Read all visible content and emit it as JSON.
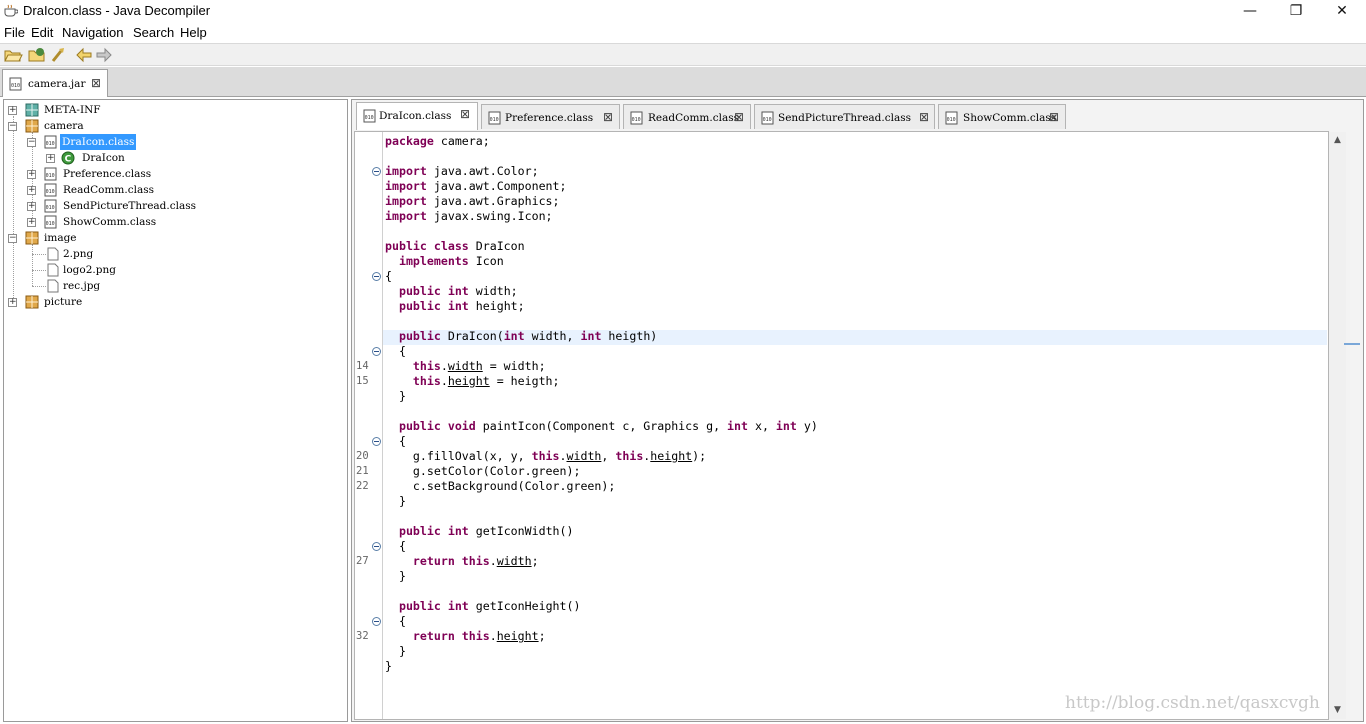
{
  "window": {
    "title": "DraIcon.class - Java Decompiler",
    "controls": {
      "minimize": "—",
      "maximize": "❐",
      "close": "✕"
    }
  },
  "menu": [
    "File",
    "Edit",
    "Navigation",
    "Search",
    "Help"
  ],
  "toolbar": {
    "buttons": [
      "open-file-icon",
      "open-type-icon",
      "open-type-hierarchy-icon",
      "back-icon",
      "forward-icon"
    ]
  },
  "outer_tabs": [
    {
      "label": "camera.jar",
      "icon": "jar-file-icon"
    }
  ],
  "tree": {
    "items": [
      {
        "label": "META-INF",
        "icon": "folder-package-icon",
        "expander": "+"
      },
      {
        "label": "camera",
        "icon": "package-icon",
        "expander": "−"
      },
      {
        "label": "DraIcon.class",
        "icon": "class-file-icon",
        "expander": "−",
        "selected": true
      },
      {
        "label": "DraIcon",
        "icon": "class-icon",
        "expander": "+"
      },
      {
        "label": "Preference.class",
        "icon": "class-file-icon",
        "expander": "+"
      },
      {
        "label": "ReadComm.class",
        "icon": "class-file-icon",
        "expander": "+"
      },
      {
        "label": "SendPictureThread.class",
        "icon": "class-file-icon",
        "expander": "+"
      },
      {
        "label": "ShowComm.class",
        "icon": "class-file-icon",
        "expander": "+"
      },
      {
        "label": "image",
        "icon": "package-icon",
        "expander": "−"
      },
      {
        "label": "2.png",
        "icon": "file-icon",
        "expander": ""
      },
      {
        "label": "logo2.png",
        "icon": "file-icon",
        "expander": ""
      },
      {
        "label": "rec.jpg",
        "icon": "file-icon",
        "expander": ""
      },
      {
        "label": "picture",
        "icon": "package-icon",
        "expander": "+"
      }
    ]
  },
  "editor_tabs": [
    {
      "label": "DraIcon.class",
      "active": true
    },
    {
      "label": "Preference.class",
      "active": false
    },
    {
      "label": "ReadComm.class",
      "active": false
    },
    {
      "label": "SendPictureThread.class",
      "active": false
    },
    {
      "label": "ShowComm.class",
      "active": false
    }
  ],
  "tab_close": "⊠",
  "code": {
    "line_numbers": [
      "14",
      "15",
      "20",
      "21",
      "22",
      "27",
      "32"
    ]
  },
  "watermark": "http://blog.csdn.net/qasxcvgh"
}
